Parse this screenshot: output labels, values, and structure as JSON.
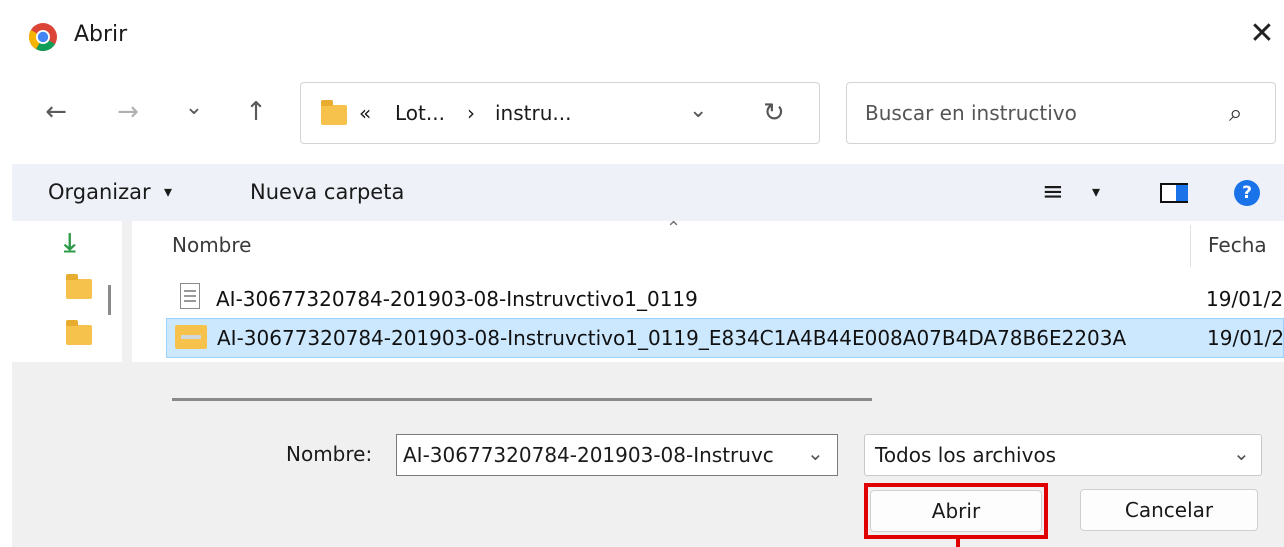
{
  "window": {
    "title": "Abrir",
    "close_glyph": "✕"
  },
  "nav": {
    "back_glyph": "←",
    "forward_glyph": "→",
    "recent_glyph": "⌄",
    "up_glyph": "↑",
    "path_prefix": "«",
    "crumb1": "Lot...",
    "crumb_sep": "›",
    "crumb2": "instru...",
    "dropdown_glyph": "⌄",
    "refresh_glyph": "↻",
    "search_placeholder": "Buscar en instructivo",
    "search_glyph": "⌕"
  },
  "toolbar": {
    "organize_label": "Organizar",
    "organize_caret": "▾",
    "new_folder_label": "Nueva carpeta",
    "view_glyph": "≡",
    "view_caret": "▾",
    "help_glyph": "?"
  },
  "list": {
    "sort_glyph": "⌃",
    "columns": [
      "Nombre",
      "Fecha"
    ],
    "rows": [
      {
        "name": "AI-30677320784-201903-08-Instruvctivo1_0119",
        "date": "19/01/2"
      },
      {
        "name": "AI-30677320784-201903-08-Instruvctivo1_0119_E834C1A4B44E008A07B4DA78B6E2203A",
        "date": "19/01/2"
      }
    ]
  },
  "footer": {
    "filename_label": "Nombre:",
    "filename_value": "AI-30677320784-201903-08-Instruvc",
    "filename_caret": "⌄",
    "filetype_value": "Todos los archivos",
    "filetype_caret": "⌄",
    "open_label": "Abrir",
    "cancel_label": "Cancelar"
  },
  "colors": {
    "highlight": "#e00000",
    "selection": "#cce8ff",
    "help_blue": "#1a73e8"
  }
}
